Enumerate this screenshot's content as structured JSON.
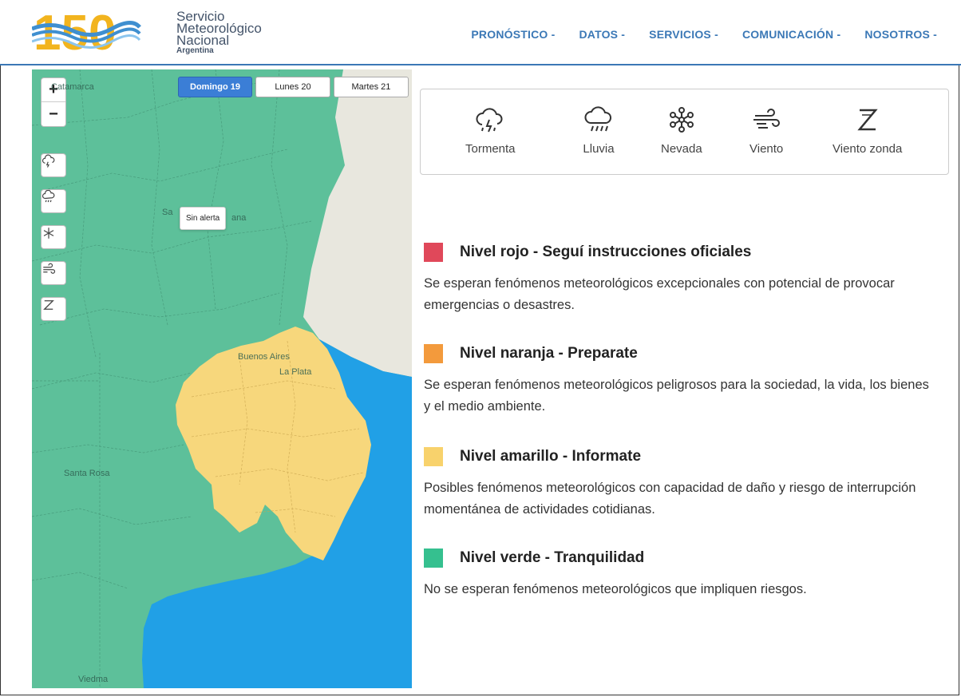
{
  "header": {
    "logo_number": "150",
    "logo_line1": "Servicio",
    "logo_line2": "Meteorológico",
    "logo_line3": "Nacional",
    "logo_line4": "Argentina",
    "nav": [
      "PRONÓSTICO",
      "DATOS",
      "SERVICIOS",
      "COMUNICACIÓN",
      "NOSOTROS"
    ]
  },
  "map": {
    "zoom_in": "+",
    "zoom_out": "−",
    "tabs": [
      "Domingo 19",
      "Lunes 20",
      "Martes 21"
    ],
    "active_tab": "Domingo 19",
    "tooltip": "Sin alerta",
    "places": {
      "catamarca": "Catamarca",
      "santa_fe_partial": "Sa",
      "santa_fe_partial2": "ana",
      "buenos_aires": "Buenos Aires",
      "la_plata": "La Plata",
      "santa_rosa": "Santa Rosa",
      "viedma": "Viedma"
    },
    "colors": {
      "green": "#5dc09a",
      "yellow": "#f7d77c",
      "sea": "#21a0e6",
      "land": "#e8e7de"
    }
  },
  "phenomena": [
    {
      "label": "Tormenta",
      "icon": "storm-icon"
    },
    {
      "label": "Lluvia",
      "icon": "rain-icon"
    },
    {
      "label": "Nevada",
      "icon": "snow-icon"
    },
    {
      "label": "Viento",
      "icon": "wind-icon"
    },
    {
      "label": "Viento zonda",
      "icon": "zonda-icon"
    }
  ],
  "levels": [
    {
      "color": "#e0485a",
      "title": "Nivel rojo - Seguí instrucciones oficiales",
      "desc": "Se esperan fenómenos meteorológicos excepcionales con potencial de provocar emergencias o desastres."
    },
    {
      "color": "#f39a3c",
      "title": "Nivel naranja - Preparate",
      "desc": "Se esperan fenómenos meteorológicos peligrosos para la sociedad, la vida, los bienes y el medio ambiente."
    },
    {
      "color": "#f8d26c",
      "title": "Nivel amarillo - Informate",
      "desc": "Posibles fenómenos meteorológicos con capacidad de daño y riesgo de interrupción momentánea de actividades cotidianas."
    },
    {
      "color": "#35c08f",
      "title": "Nivel verde - Tranquilidad",
      "desc": "No se esperan fenómenos meteorológicos que impliquen riesgos."
    }
  ]
}
